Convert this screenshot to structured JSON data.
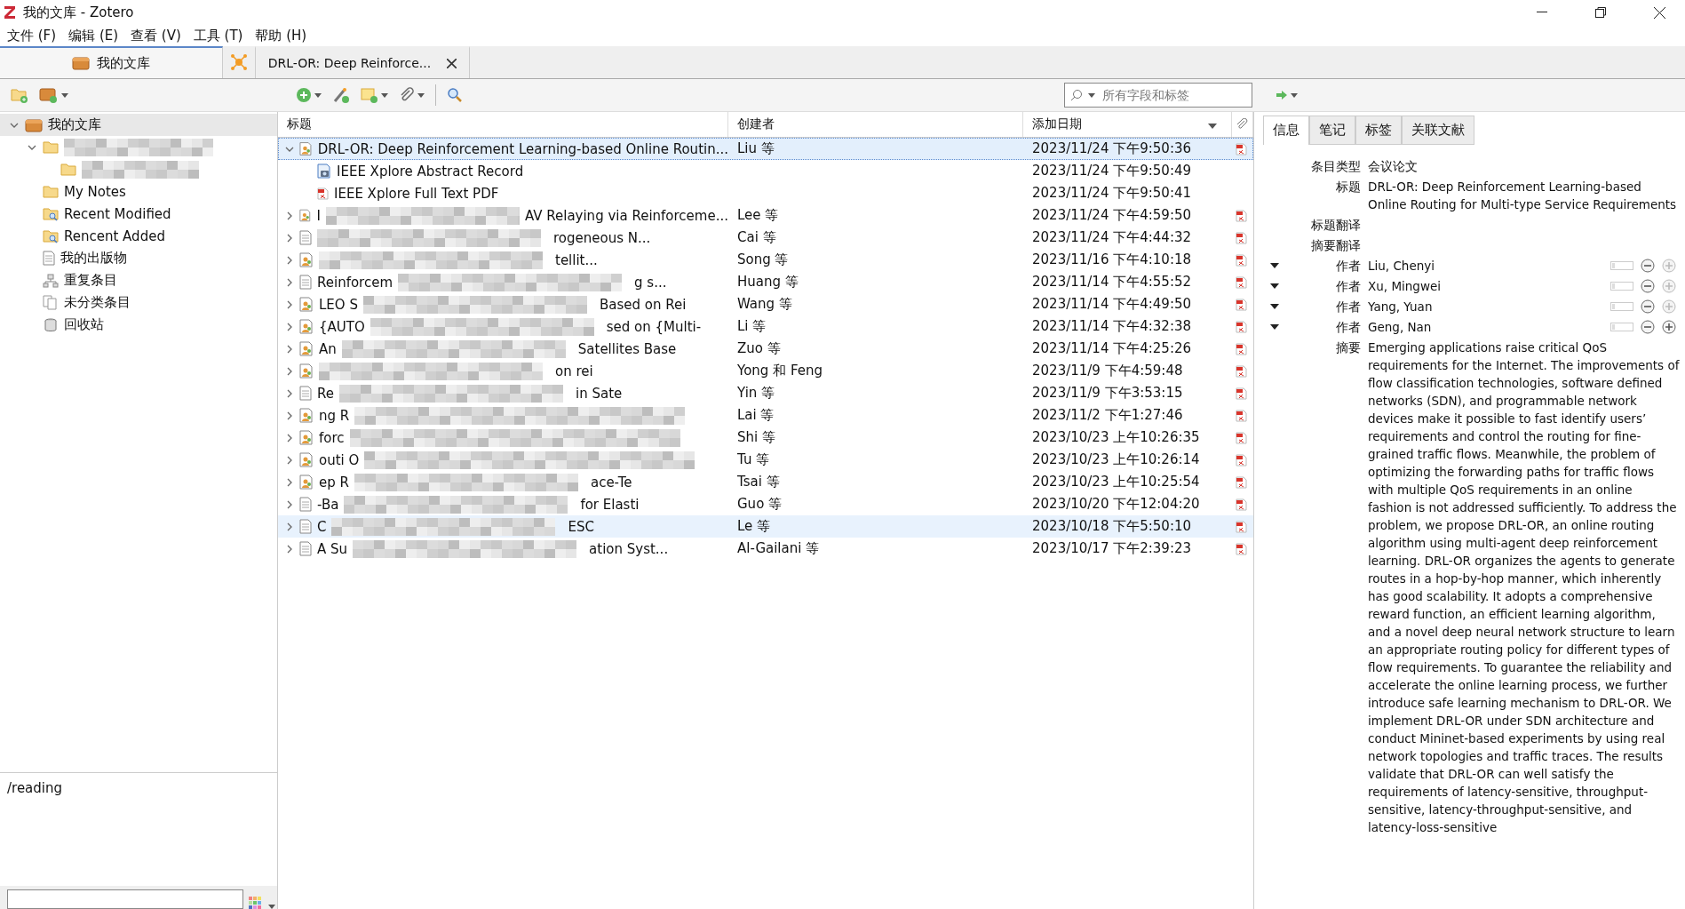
{
  "window": {
    "title": "我的文库 - Zotero"
  },
  "menu": [
    "文件 (F)",
    "编辑 (E)",
    "查看 (V)",
    "工具 (T)",
    "帮助 (H)"
  ],
  "tabs": [
    {
      "kind": "library",
      "label": "我的文库",
      "selected": true
    },
    {
      "kind": "reader",
      "label": "DRL-OR: Deep Reinforce...",
      "selected": false
    }
  ],
  "search": {
    "placeholder": "所有字段和标签"
  },
  "collections": {
    "label": "我的文库",
    "expanded": true,
    "children": [
      {
        "kind": "redacted",
        "expanded": true,
        "children": [
          {
            "kind": "redacted"
          }
        ]
      },
      {
        "kind": "folder",
        "label": "My Notes"
      },
      {
        "kind": "saved-search",
        "label": "Recent Modified"
      },
      {
        "kind": "saved-search",
        "label": "Rencent Added"
      },
      {
        "kind": "publications",
        "label": "我的出版物"
      },
      {
        "kind": "duplicates",
        "label": "重复条目"
      },
      {
        "kind": "unfiled",
        "label": "未分类条目"
      },
      {
        "kind": "trash",
        "label": "回收站"
      }
    ]
  },
  "tag_pane": {
    "tags": [
      "/reading"
    ]
  },
  "table": {
    "columns": [
      "标题",
      "创建者",
      "添加日期"
    ],
    "rows": [
      {
        "kind": "conference",
        "title": "DRL-OR: Deep Reinforcement Learning-based Online Routin...",
        "creator": "Liu 等",
        "date": "2023/11/24 下午9:50:36",
        "pdf": true,
        "expanded": true,
        "selected": true,
        "hovered": false,
        "children": [
          {
            "kind": "snapshot",
            "title": "IEEE Xplore Abstract Record",
            "date": "2023/11/24 下午9:50:49"
          },
          {
            "kind": "pdf",
            "title": "IEEE Xplore Full Text PDF",
            "date": "2023/11/24 下午9:50:41"
          }
        ]
      },
      {
        "kind": "conference",
        "title_start": "I",
        "title_end": "AV Relaying via Reinforceme...",
        "creator": "Lee 等",
        "date": "2023/11/24 下午4:59:50",
        "pdf": true,
        "expanded": false,
        "selected": false,
        "hovered": false
      },
      {
        "kind": "document",
        "title_end": "rogeneous N...",
        "creator": "Cai 等",
        "date": "2023/11/24 下午4:44:32",
        "pdf": true,
        "expanded": false,
        "selected": false,
        "hovered": false
      },
      {
        "kind": "conference",
        "title_end": "tellit...",
        "creator": "Song 等",
        "date": "2023/11/16 下午4:10:18",
        "pdf": true,
        "expanded": false,
        "selected": false,
        "hovered": false
      },
      {
        "kind": "document",
        "title_start": "Reinforcem",
        "title_end": "g s...",
        "creator": "Huang 等",
        "date": "2023/11/14 下午4:55:52",
        "pdf": true,
        "expanded": false,
        "selected": false,
        "hovered": false
      },
      {
        "kind": "conference",
        "title_start": "LEO S",
        "title_end": "Based on Rei",
        "creator": "Wang 等",
        "date": "2023/11/14 下午4:49:50",
        "pdf": true,
        "expanded": false,
        "selected": false,
        "hovered": false
      },
      {
        "kind": "conference",
        "title_start": "{AUTO",
        "title_end": "sed on {Multi-",
        "creator": "Li 等",
        "date": "2023/11/14 下午4:32:38",
        "pdf": true,
        "expanded": false,
        "selected": false,
        "hovered": false
      },
      {
        "kind": "conference",
        "title_start": "An",
        "title_end": "Satellites Base",
        "creator": "Zuo 等",
        "date": "2023/11/14 下午4:25:26",
        "pdf": true,
        "expanded": false,
        "selected": false,
        "hovered": false
      },
      {
        "kind": "conference",
        "title_end": "on rei",
        "creator": "Yong 和 Feng",
        "date": "2023/11/9 下午4:59:48",
        "pdf": true,
        "expanded": false,
        "selected": false,
        "hovered": false
      },
      {
        "kind": "document",
        "title_start": "Re",
        "title_end": "in Sate",
        "creator": "Yin 等",
        "date": "2023/11/9 下午3:53:15",
        "pdf": true,
        "expanded": false,
        "selected": false,
        "hovered": false
      },
      {
        "kind": "conference",
        "title_start": "ng R",
        "creator": "Lai 等",
        "date": "2023/11/2 下午1:27:46",
        "pdf": true,
        "expanded": false,
        "selected": false,
        "hovered": false
      },
      {
        "kind": "conference",
        "title_start": "forc",
        "creator": "Shi 等",
        "date": "2023/10/23 上午10:26:35",
        "pdf": true,
        "expanded": false,
        "selected": false,
        "hovered": false
      },
      {
        "kind": "conference",
        "title_start": "outi O",
        "creator": "Tu 等",
        "date": "2023/10/23 上午10:26:14",
        "pdf": true,
        "expanded": false,
        "selected": false,
        "hovered": false
      },
      {
        "kind": "conference",
        "title_start": "ep R",
        "title_end": "ace-Te",
        "creator": "Tsai 等",
        "date": "2023/10/23 上午10:25:54",
        "pdf": true,
        "expanded": false,
        "selected": false,
        "hovered": false
      },
      {
        "kind": "document",
        "title_start": "-Ba",
        "title_end": "for Elasti",
        "creator": "Guo 等",
        "date": "2023/10/20 下午12:04:20",
        "pdf": true,
        "expanded": false,
        "selected": false,
        "hovered": false
      },
      {
        "kind": "document",
        "title_start": "C",
        "title_end": "ESC",
        "creator": "Le 等",
        "date": "2023/10/18 下午5:50:10",
        "pdf": true,
        "expanded": false,
        "selected": false,
        "hovered": true
      },
      {
        "kind": "document",
        "title_start": "A Su",
        "title_end": "ation Syst...",
        "creator": "Al-Gailani 等",
        "date": "2023/10/17 下午2:39:23",
        "pdf": true,
        "expanded": false,
        "selected": false,
        "hovered": false
      }
    ]
  },
  "item_pane": {
    "tabs": [
      {
        "label": "信息",
        "selected": true
      },
      {
        "label": "笔记",
        "selected": false
      },
      {
        "label": "标签",
        "selected": false
      },
      {
        "label": "关联文献",
        "selected": false
      }
    ],
    "fields": [
      {
        "label": "条目类型",
        "value": "会议论文"
      },
      {
        "label": "标题",
        "value": "DRL-OR: Deep Reinforcement Learning-based Online Routing for Multi-type Service Requirements"
      },
      {
        "label": "标题翻译"
      },
      {
        "label": "摘要翻译"
      }
    ],
    "creators": [
      {
        "role": "作者",
        "name": "Liu, Chenyi",
        "add_enabled": false
      },
      {
        "role": "作者",
        "name": "Xu, Mingwei",
        "add_enabled": false
      },
      {
        "role": "作者",
        "name": "Yang, Yuan",
        "add_enabled": false
      },
      {
        "role": "作者",
        "name": "Geng, Nan",
        "add_enabled": true
      }
    ],
    "abstract": {
      "label": "摘要",
      "value": "Emerging applications raise critical QoS requirements for the Internet. The improvements of flow classification technologies, software defined networks (SDN), and programmable network devices make it possible to fast identify users’ requirements and control the routing for fine-grained traffic flows. Meanwhile, the problem of optimizing the forwarding paths for traffic flows with multiple QoS requirements in an online fashion is not addressed sufficiently. To address the problem, we propose DRL-OR, an online routing algorithm using multi-agent deep reinforcement learning. DRL-OR organizes the agents to generate routes in a hop-by-hop manner, which inherently has good scalability. It adopts a comprehensive reward function, an efficient learning algorithm, and a novel deep neural network structure to learn an appropriate routing policy for different types of flow requirements. To guarantee the reliability and accelerate the online learning process, we further introduce safe learning mechanism to DRL-OR. We implement DRL-OR under SDN architecture and conduct Mininet-based experiments by using real network topologies and traffic traces. The results validate that DRL-OR can well satisfy the requirements of latency-sensitive, throughput-sensitive, latency-throughput-sensitive, and latency-loss-sensitive"
    }
  }
}
